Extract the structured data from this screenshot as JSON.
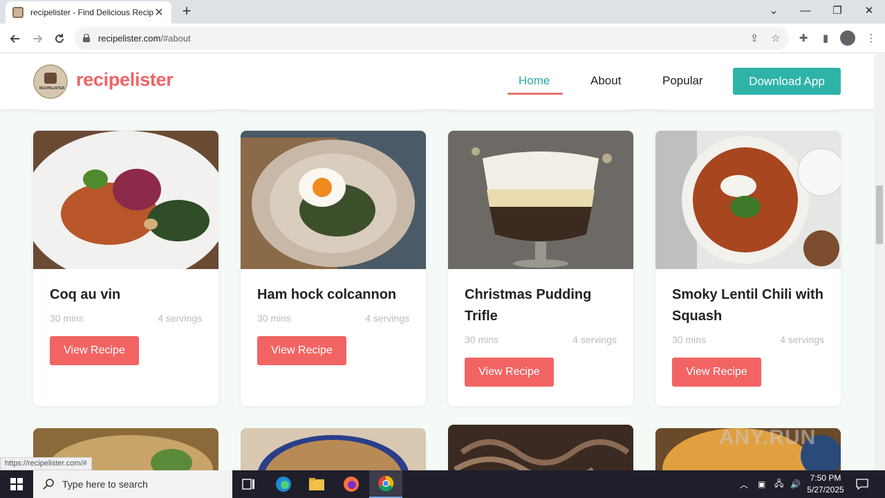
{
  "browser": {
    "tab_title": "recipelister - Find Delicious Recip",
    "url_domain": "recipelister.com",
    "url_path": "/#about",
    "status_url": "https://recipelister.com/#"
  },
  "site": {
    "logo_text": "recipelister",
    "logo_badge_text": "RECIPELISTER",
    "nav": {
      "home": "Home",
      "about": "About",
      "popular": "Popular",
      "download": "Download App"
    }
  },
  "recipes": [
    {
      "name": "Coq au vin",
      "time": "30 mins",
      "servings": "4 servings",
      "button": "View Recipe"
    },
    {
      "name": "Ham hock colcannon",
      "time": "30 mins",
      "servings": "4 servings",
      "button": "View Recipe"
    },
    {
      "name": "Christmas Pudding Trifle",
      "time": "30 mins",
      "servings": "4 servings",
      "button": "View Recipe"
    },
    {
      "name": "Smoky Lentil Chili with Squash",
      "time": "30 mins",
      "servings": "4 servings",
      "button": "View Recipe"
    }
  ],
  "watermark": "ANY.RUN",
  "taskbar": {
    "search_placeholder": "Type here to search",
    "time": "7:50 PM",
    "date": "5/27/2025"
  },
  "colors": {
    "brand_coral": "#f26464",
    "brand_teal": "#2fb3a8"
  }
}
